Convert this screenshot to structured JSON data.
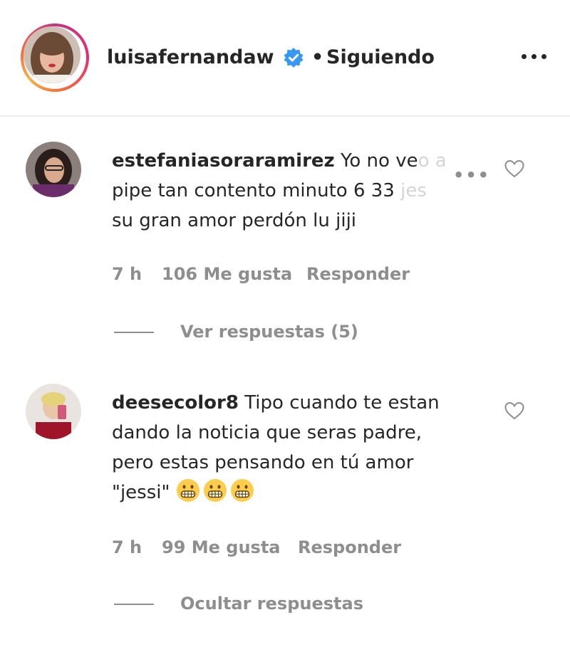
{
  "header": {
    "username": "luisafernandaw",
    "separator": "•",
    "follow_status": "Siguiendo"
  },
  "comments": [
    {
      "username": "estefaniasoraramirez",
      "text": "Yo no veo a pipe tan contento minuto 6 33",
      "text_hidden_end": "jes su gran amor perdón lu jiji",
      "line1": "Yo no ve",
      "line1_faded": "o a",
      "line2": "pipe tan contento minuto 6 33 ",
      "line2_faded": "jes",
      "line3": "su gran amor perdón lu jiji",
      "time": "7 h",
      "likes": "106 Me gusta",
      "reply_label": "Responder",
      "replies_toggle": "Ver respuestas (5)"
    },
    {
      "username": "deesecolor8",
      "line1": "Tipo cuando te estan",
      "line2": "dando la noticia que seras padre,",
      "line3": "pero estas pensando en tú amor",
      "line4": "\"jessi\"",
      "emojis": [
        "grimacing-face",
        "grimacing-face",
        "grimacing-face"
      ],
      "time": "7 h",
      "likes": "99 Me gusta",
      "reply_label": "Responder",
      "replies_toggle": "Ocultar respuestas"
    }
  ],
  "colors": {
    "text": "#262626",
    "secondary": "#8e8e8e",
    "verified": "#3897f0",
    "divider": "#efefef"
  }
}
